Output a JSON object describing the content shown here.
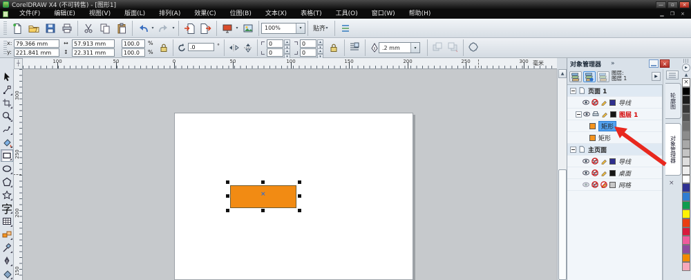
{
  "titlebar": {
    "title": "CorelDRAW X4 (不可转售) - [图形1]"
  },
  "menubar": {
    "items": [
      "文件(F)",
      "编辑(E)",
      "视图(V)",
      "版面(L)",
      "排列(A)",
      "效果(C)",
      "位图(B)",
      "文本(X)",
      "表格(T)",
      "工具(O)",
      "窗口(W)",
      "帮助(H)"
    ]
  },
  "toolbar": {
    "zoom_level": "100%",
    "snap_label": "贴齐"
  },
  "propbar": {
    "x_label": "x:",
    "x_value": "79.366 mm",
    "y_label": "y:",
    "y_value": "221.841 mm",
    "width_value": "57.913 mm",
    "height_value": "22.311 mm",
    "scale_h": "100.0",
    "scale_v": "100.0",
    "percent": "%",
    "angle_value": ".0",
    "degree_symbol": "°",
    "corner_tl": "0",
    "corner_tr": "0",
    "corner_bl": "0",
    "corner_br": "0",
    "outline_width": ".2 mm"
  },
  "ruler": {
    "unit": "毫米",
    "h_labels": [
      "100",
      "50",
      "0",
      "50",
      "100",
      "150",
      "200",
      "250",
      "300"
    ],
    "v_labels": [
      "300",
      "250",
      "200",
      "150"
    ]
  },
  "canvas": {
    "rect_fill": "#f28b13"
  },
  "docker": {
    "title": "对象管理器",
    "layer_caption": "图层:",
    "active_layer": "图层 1",
    "tree": {
      "page1": "页面 1",
      "guides1": "导线",
      "layer1": "图层 1",
      "rect1": "矩形",
      "rect2": "矩形",
      "master": "主页面",
      "guides2": "导线",
      "desktop": "桌面",
      "grid": "网格"
    },
    "swatches": {
      "guides": "#2e2f8f",
      "layer1": "#161616",
      "rect": "#f5941f",
      "desktop": "#161616",
      "grid": "#c8c8c8"
    }
  },
  "tabstrip": {
    "tab1": "轮廓图",
    "tab2": "对象管理器"
  },
  "palette": {
    "colors": [
      "#000000",
      "#1c1c1c",
      "#383838",
      "#545454",
      "#707070",
      "#8c8c8c",
      "#a8a8a8",
      "#c4c4c4",
      "#dedede",
      "#efefef",
      "#ffffff",
      "#2e3192",
      "#2f7dd1",
      "#0e9c4e",
      "#fff200",
      "#ea3e12",
      "#d81a3c",
      "#ef5b9c",
      "#8e4a9e",
      "#f28a00",
      "#f7a7bb"
    ]
  },
  "glyphs": {
    "dropdown": "▾",
    "spin_up": "▴",
    "spin_down": "▾",
    "chevrons": "»",
    "close_x": "×",
    "flyout": "▶",
    "scroll_up": "▲",
    "palette_up": "▲",
    "no_fill_x": "×",
    "center_x": "×",
    "minimize_dash": "—",
    "h_arrow": "↔",
    "v_arrow": "↕",
    "origin_cross": "┼",
    "text_tool": "字"
  }
}
